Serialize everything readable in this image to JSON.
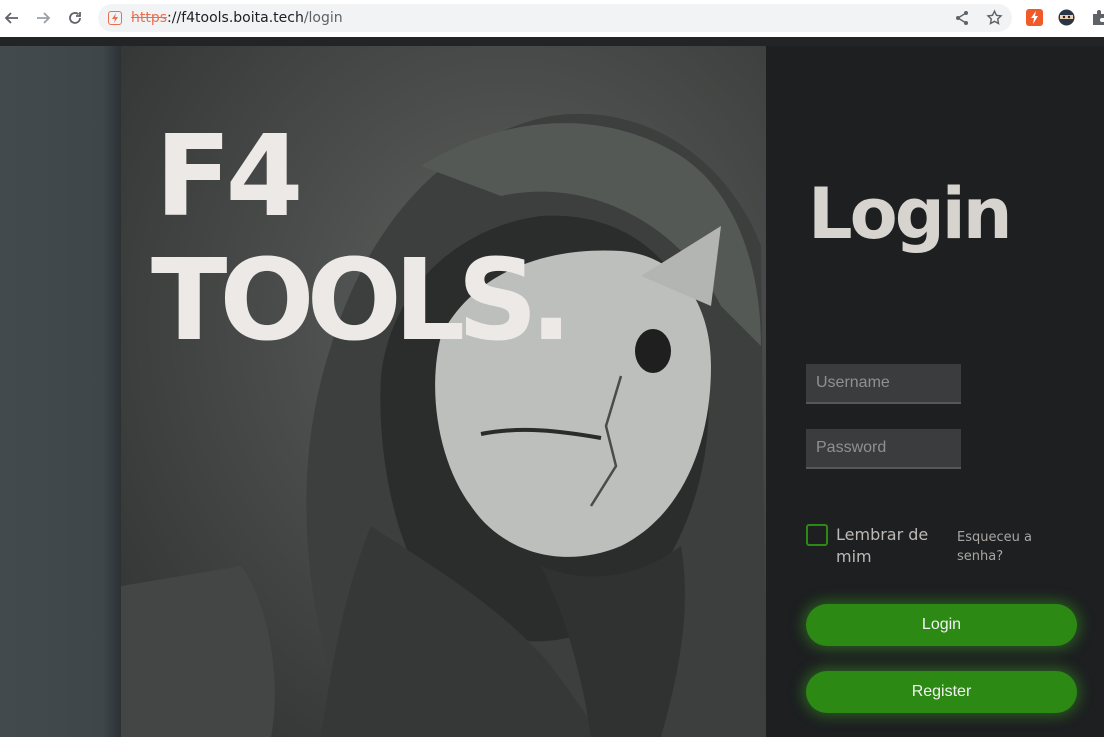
{
  "browser": {
    "url_scheme": "https",
    "url_host": "://f4tools.boita.tech",
    "url_path": "/login"
  },
  "hero": {
    "brand_line1": "F4",
    "brand_line2": "TOOLS."
  },
  "login_panel": {
    "title": "Login",
    "username_placeholder": "Username",
    "password_placeholder": "Password",
    "remember_label": "Lembrar de mim",
    "forgot_link": "Esqueceu a senha?",
    "login_button": "Login",
    "register_button": "Register"
  },
  "colors": {
    "accent_green": "#2c8a14",
    "panel_bg": "#1d1f21",
    "title_text": "#d7d3cf"
  },
  "icons": [
    "back-arrow-icon",
    "forward-arrow-icon",
    "reload-icon",
    "site-info-icon",
    "share-icon",
    "bookmark-star-icon",
    "extension-orange-icon",
    "extension-ninja-icon",
    "extensions-puzzle-icon"
  ]
}
